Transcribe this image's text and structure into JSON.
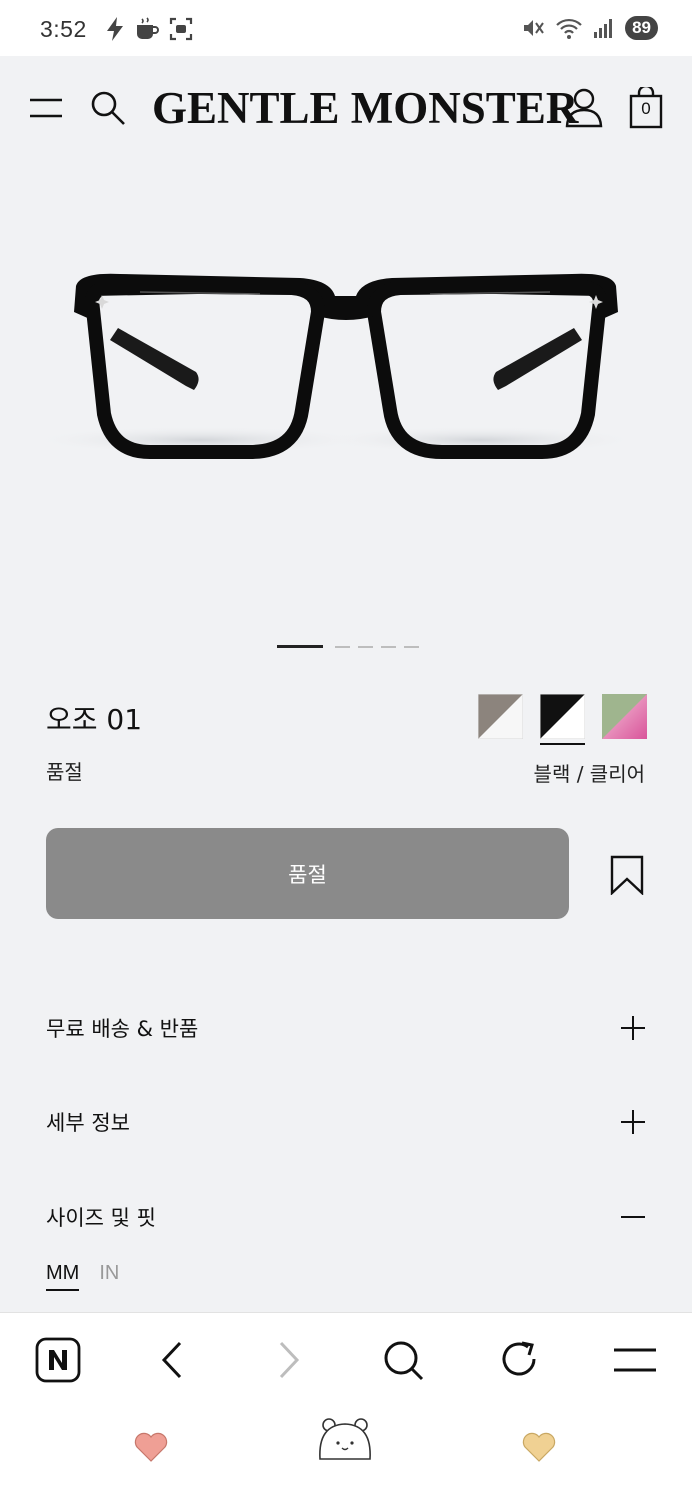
{
  "status_bar": {
    "time": "3:52",
    "battery": "89"
  },
  "header": {
    "brand": "GENTLE MONSTER",
    "cart_count": "0"
  },
  "product": {
    "name": "오조 01",
    "stock_status": "품절",
    "color_name": "블랙 / 클리어",
    "image_pages": 5,
    "current_image": 1,
    "swatches": [
      {
        "name": "taupe",
        "color": "#8c847d"
      },
      {
        "name": "black-clear",
        "color": "#111111",
        "selected": true
      },
      {
        "name": "green-pink",
        "color": "#9fb58e"
      }
    ],
    "primary_button_label": "품절"
  },
  "sections": [
    {
      "label": "무료 배송 & 반품",
      "state": "collapsed"
    },
    {
      "label": "세부 정보",
      "state": "collapsed"
    },
    {
      "label": "사이즈 및 핏",
      "state": "expanded"
    }
  ],
  "size_units": [
    {
      "label": "MM",
      "active": true
    },
    {
      "label": "IN",
      "active": false
    }
  ],
  "browser_nav": [
    "naver-icon",
    "back-icon",
    "forward-icon",
    "search-icon",
    "refresh-icon",
    "menu-icon"
  ],
  "colors": {
    "background": "#f1f2f4",
    "soldout_button": "#8a8a8a",
    "text": "#111111"
  }
}
